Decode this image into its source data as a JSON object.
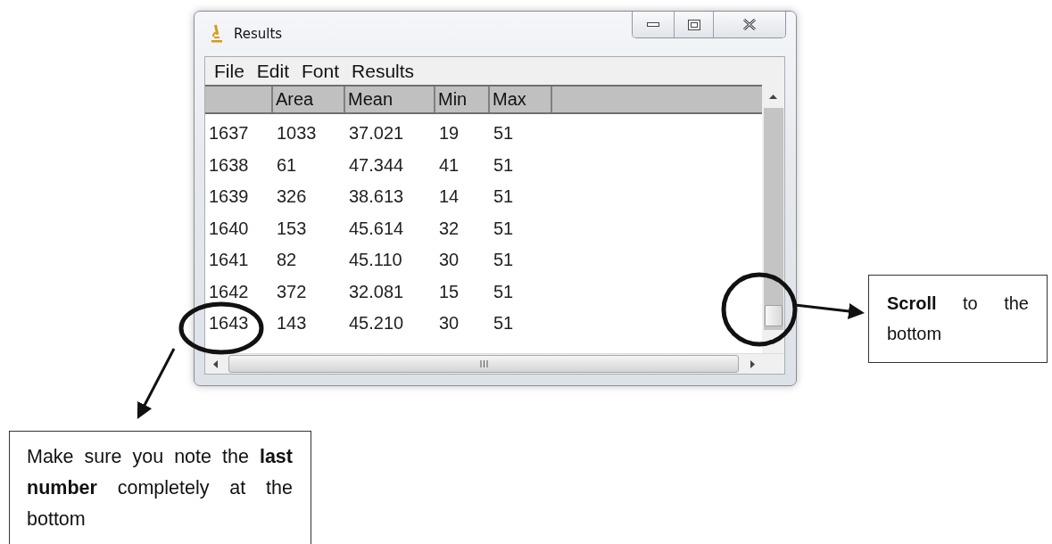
{
  "window": {
    "title": "Results"
  },
  "menu": [
    "File",
    "Edit",
    "Font",
    "Results"
  ],
  "table": {
    "columns": [
      "Area",
      "Mean",
      "Min",
      "Max"
    ],
    "rows": [
      {
        "label": "1637",
        "cells": [
          "1033",
          "37.021",
          "19",
          "51"
        ]
      },
      {
        "label": "1638",
        "cells": [
          "61",
          "47.344",
          "41",
          "51"
        ]
      },
      {
        "label": "1639",
        "cells": [
          "326",
          "38.613",
          "14",
          "51"
        ]
      },
      {
        "label": "1640",
        "cells": [
          "153",
          "45.614",
          "32",
          "51"
        ]
      },
      {
        "label": "1641",
        "cells": [
          "82",
          "45.110",
          "30",
          "51"
        ]
      },
      {
        "label": "1642",
        "cells": [
          "372",
          "32.081",
          "15",
          "51"
        ]
      },
      {
        "label": "1643",
        "cells": [
          "143",
          "45.210",
          "30",
          "51"
        ]
      }
    ]
  },
  "callouts": [
    {
      "kind": "right",
      "text": "**Scroll** to the bottom"
    },
    {
      "kind": "bottom",
      "text": "Make sure you note the **last number** completely at the bottom"
    }
  ]
}
